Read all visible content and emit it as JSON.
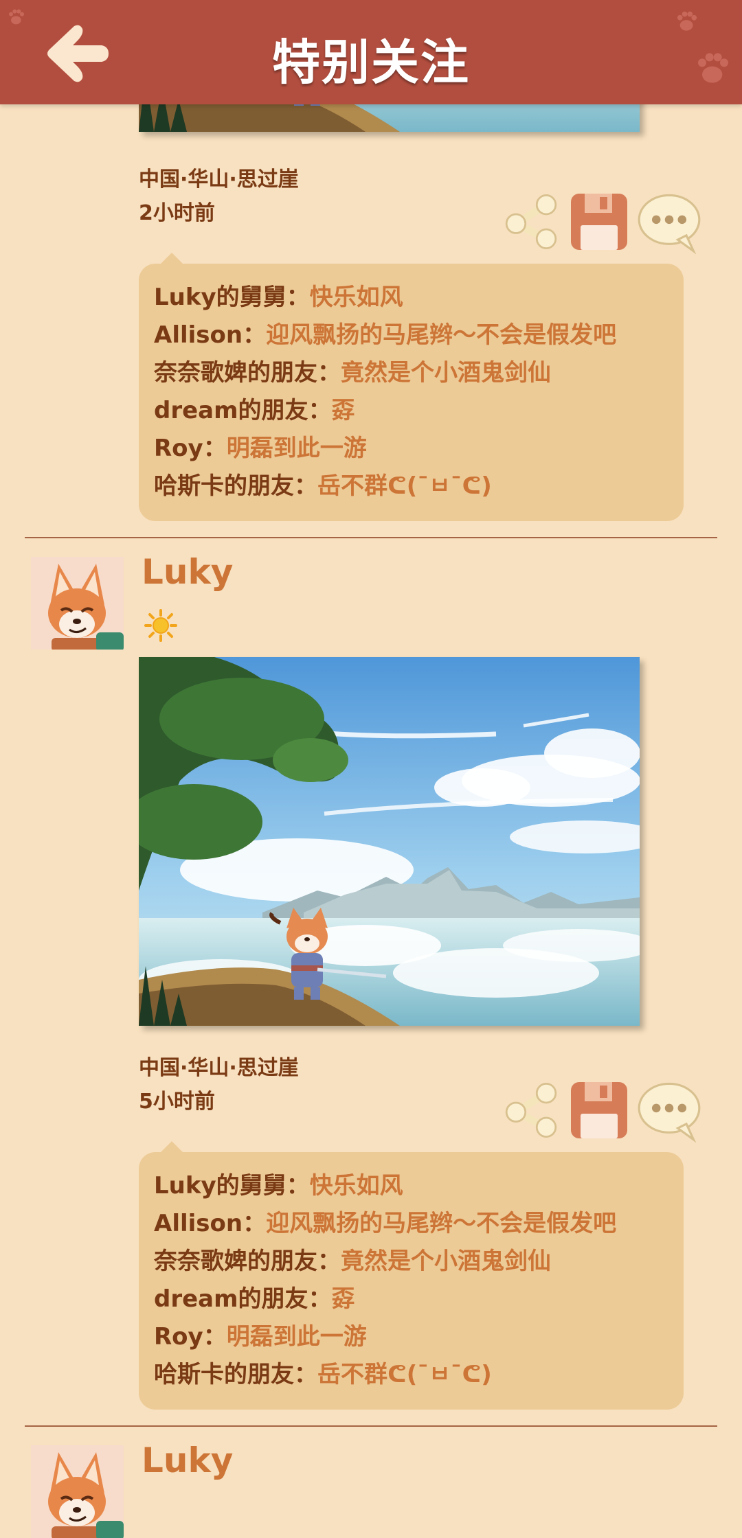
{
  "header": {
    "title": "特别关注"
  },
  "posts": [
    {
      "location": "中国·华山·思过崖",
      "time": "2小时前",
      "comments": [
        {
          "name": "Luky的舅舅：",
          "text": "快乐如风"
        },
        {
          "name": "Allison：",
          "text": "迎风飘扬的马尾辫～不会是假发吧"
        },
        {
          "name": "奈奈歌婢的朋友：",
          "text": "竟然是个小酒鬼剑仙"
        },
        {
          "name": "dream的朋友：",
          "text": "孬"
        },
        {
          "name": "Roy：",
          "text": "明磊到此一游"
        },
        {
          "name": "哈斯卡的朋友：",
          "text": "岳不群ᕦ(¯ㅂ¯ᕦ)"
        }
      ]
    },
    {
      "username": "Luky",
      "status_icon": "sun-icon",
      "location": "中国·华山·思过崖",
      "time": "5小时前",
      "comments": [
        {
          "name": "Luky的舅舅：",
          "text": "快乐如风"
        },
        {
          "name": "Allison：",
          "text": "迎风飘扬的马尾辫～不会是假发吧"
        },
        {
          "name": "奈奈歌婢的朋友：",
          "text": "竟然是个小酒鬼剑仙"
        },
        {
          "name": "dream的朋友：",
          "text": "孬"
        },
        {
          "name": "Roy：",
          "text": "明磊到此一游"
        },
        {
          "name": "哈斯卡的朋友：",
          "text": "岳不群ᕦ(¯ㅂ¯ᕦ)"
        }
      ]
    },
    {
      "username": "Luky"
    }
  ],
  "icons": {
    "back": "back-arrow-icon",
    "share": "share-icon",
    "save": "save-icon",
    "comment": "comment-icon"
  },
  "colors": {
    "header": "#b24e3f",
    "background": "#f8e1c0",
    "comment_box": "#edcb97",
    "name_text": "#7a3a14",
    "accent_text": "#cc7537"
  }
}
